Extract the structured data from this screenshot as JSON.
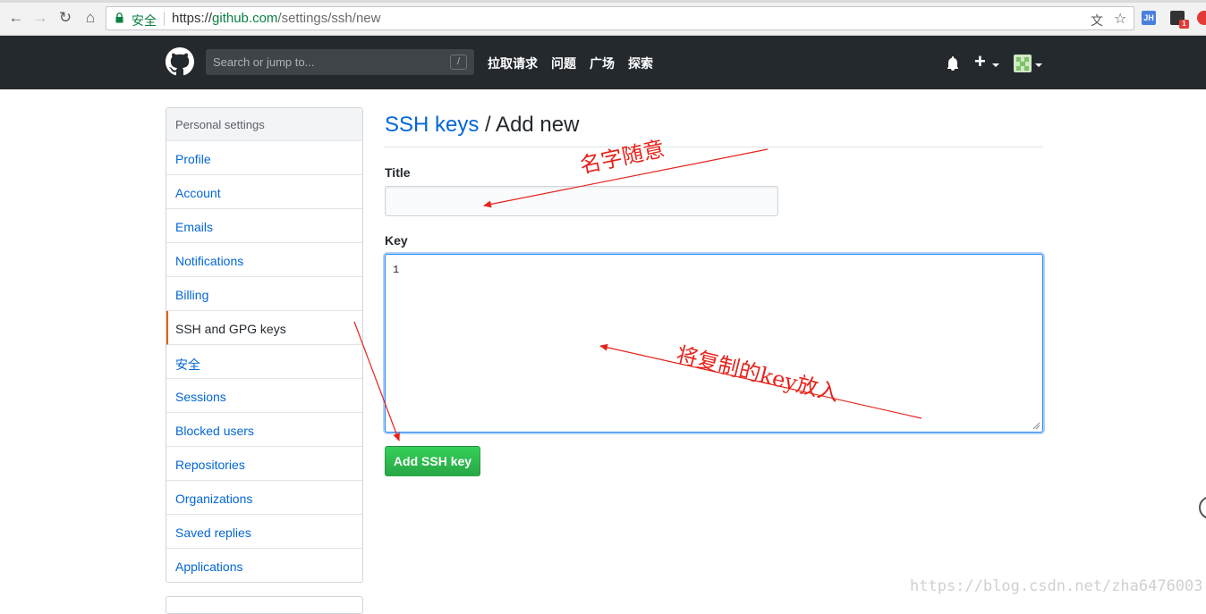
{
  "browser": {
    "secure_label": "安全",
    "url_scheme": "https://",
    "url_host": "github.com",
    "url_path": "/settings/ssh/new",
    "extensions": [
      {
        "label": "JH",
        "color": "#4a7fe0"
      },
      {
        "label": "1",
        "color": "#e53935"
      }
    ]
  },
  "header": {
    "search_placeholder": "Search or jump to...",
    "search_shortcut": "/",
    "nav": [
      "拉取请求",
      "问题",
      "广场",
      "探索"
    ],
    "plus": "+"
  },
  "sidebar": {
    "heading": "Personal settings",
    "items": [
      {
        "label": "Profile",
        "selected": false
      },
      {
        "label": "Account",
        "selected": false
      },
      {
        "label": "Emails",
        "selected": false
      },
      {
        "label": "Notifications",
        "selected": false
      },
      {
        "label": "Billing",
        "selected": false
      },
      {
        "label": "SSH and GPG keys",
        "selected": true
      },
      {
        "label": "安全",
        "selected": false
      },
      {
        "label": "Sessions",
        "selected": false
      },
      {
        "label": "Blocked users",
        "selected": false
      },
      {
        "label": "Repositories",
        "selected": false
      },
      {
        "label": "Organizations",
        "selected": false
      },
      {
        "label": "Saved replies",
        "selected": false
      },
      {
        "label": "Applications",
        "selected": false
      }
    ]
  },
  "main": {
    "breadcrumb_link": "SSH keys",
    "breadcrumb_rest": " / Add new",
    "title_label": "Title",
    "title_value": "",
    "key_label": "Key",
    "key_value": "1",
    "submit_label": "Add SSH key"
  },
  "annotations": {
    "title_note": "名字随意",
    "key_note": "将复制的key放入",
    "color": "#e6231b"
  },
  "watermark": "https://blog.csdn.net/zha6476003"
}
